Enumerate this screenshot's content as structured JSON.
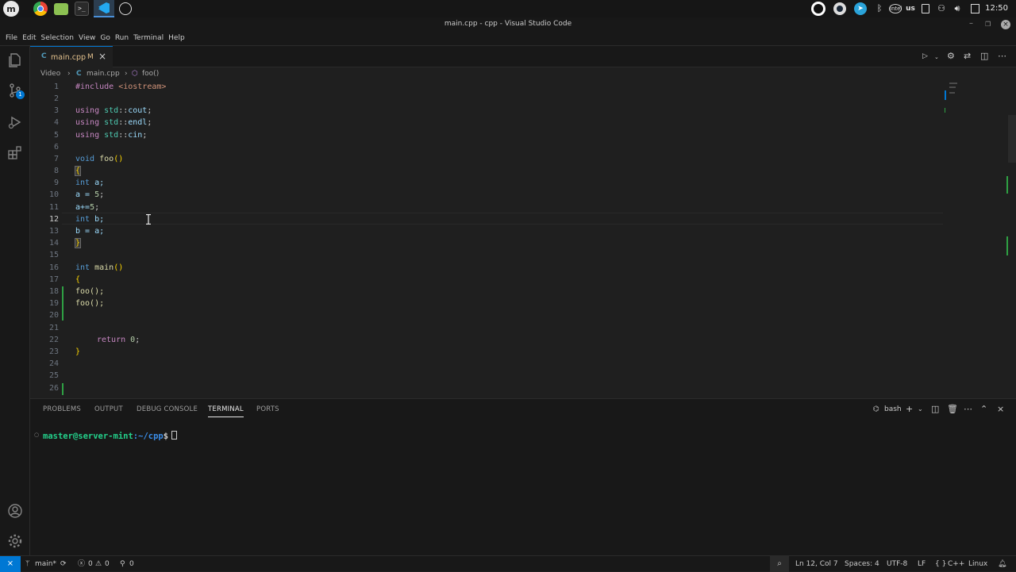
{
  "window": {
    "title": "main.cpp - cpp - Visual Studio Code"
  },
  "taskbar": {
    "clock": "12:50",
    "keyboard": "us"
  },
  "menu": {
    "items": [
      "File",
      "Edit",
      "Selection",
      "View",
      "Go",
      "Run",
      "Terminal",
      "Help"
    ]
  },
  "tab": {
    "icon": "C",
    "label": "main.cpp",
    "modified": "M"
  },
  "breadcrumb": {
    "folder": "Video",
    "file": "main.cpp",
    "symbol": "foo()"
  },
  "activity": {
    "scm_badge": "1"
  },
  "editor": {
    "lines": [
      "1",
      "2",
      "3",
      "4",
      "5",
      "6",
      "7",
      "8",
      "9",
      "10",
      "11",
      "12",
      "13",
      "14",
      "15",
      "16",
      "17",
      "18",
      "19",
      "20",
      "21",
      "22",
      "23",
      "24",
      "25",
      "26"
    ],
    "code": {
      "l1_pp": "#include",
      "l1_str": "<iostream>",
      "using": "using",
      "std": "std",
      "sep": "::",
      "cout": "cout",
      "endl": "endl",
      "cin": "cin",
      "semi": ";",
      "void": "void",
      "foo": "foo",
      "parens": "()",
      "open_brace": "{",
      "close_brace": "}",
      "int": "int",
      "l9_rest": " a;",
      "l10": "a = ",
      "five": "5",
      "l11": "a+=",
      "l12_rest": " b;",
      "l13": "b = a;",
      "main": "main",
      "call": "foo();",
      "return": "return",
      "zero": "0"
    }
  },
  "panel": {
    "tabs": [
      "PROBLEMS",
      "OUTPUT",
      "DEBUG CONSOLE",
      "TERMINAL",
      "PORTS"
    ],
    "shell": "bash",
    "prompt_user": "master@server-mint",
    "prompt_path": ":~/cpp",
    "prompt_dollar": "$"
  },
  "status": {
    "branch": "main*",
    "errors": "0",
    "warnings": "0",
    "ports": "0",
    "position": "Ln 12, Col 7",
    "spaces": "Spaces: 4",
    "encoding": "UTF-8",
    "eol": "LF",
    "language": "C++",
    "os": "Linux"
  },
  "colors": {
    "accent": "#0078d4",
    "modified": "#2ea043",
    "tab_text": "#e2c08d"
  }
}
